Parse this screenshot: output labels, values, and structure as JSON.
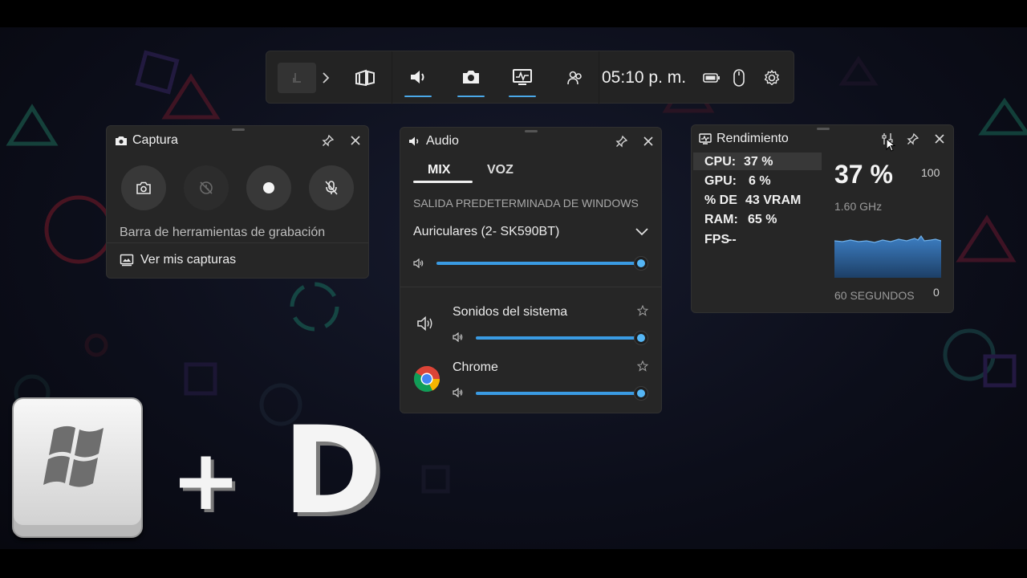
{
  "gamebar": {
    "time": "05:10 p. m."
  },
  "capture": {
    "title": "Captura",
    "recording_toolbar": "Barra de herramientas de grabación",
    "see_captures": "Ver mis capturas"
  },
  "audio": {
    "title": "Audio",
    "tabs": [
      {
        "label": "MIX",
        "active": true
      },
      {
        "label": "VOZ",
        "active": false
      }
    ],
    "section_label": "SALIDA PREDETERMINADA DE WINDOWS",
    "device": "Auriculares (2- SK590BT)",
    "master_volume": 1.0,
    "apps": [
      {
        "name": "Sonidos del sistema",
        "volume": 1.0
      },
      {
        "name": "Chrome",
        "volume": 1.0
      }
    ]
  },
  "performance": {
    "title": "Rendimiento",
    "stats": [
      {
        "label": "CPU:",
        "value": "37 %"
      },
      {
        "label": "GPU:",
        "value": "6 %"
      },
      {
        "label": "% DE",
        "value": "43 VRAM"
      },
      {
        "label": "RAM:",
        "value": "65 %"
      },
      {
        "label": "FPS",
        "value": "--"
      }
    ],
    "big_value": "37 %",
    "frequency": "1.60 GHz",
    "max_label": "100",
    "min_label": "0",
    "duration_label": "60 SEGUNDOS",
    "graph_color": "#3d7fc4"
  },
  "overlay": {
    "plus": "+",
    "key": "D"
  },
  "colors": {
    "accent": "#3a9be3",
    "panel": "#262626",
    "gamebar": "#232323"
  }
}
